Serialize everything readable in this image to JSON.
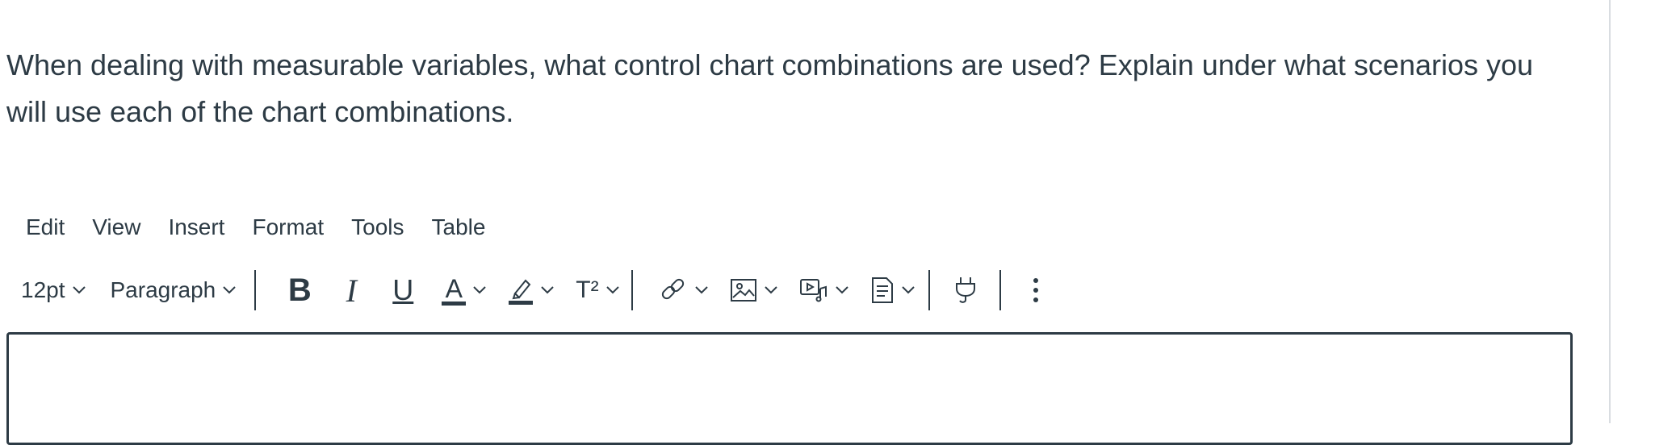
{
  "question": {
    "text": "When dealing with measurable variables, what control chart combinations are used? Explain under what scenarios you will use each of the chart combinations."
  },
  "menubar": {
    "items": [
      "Edit",
      "View",
      "Insert",
      "Format",
      "Tools",
      "Table"
    ]
  },
  "toolbar": {
    "font_size": "12pt",
    "block_format": "Paragraph",
    "bold_label": "B",
    "italic_label": "I",
    "underline_label": "U",
    "text_color_label": "A",
    "superscript_label": "T²",
    "icons": [
      "chevron-down-icon",
      "highlighter-icon",
      "link-icon",
      "image-icon",
      "media-icon",
      "document-icon",
      "plug-icon",
      "more-options-icon"
    ]
  }
}
